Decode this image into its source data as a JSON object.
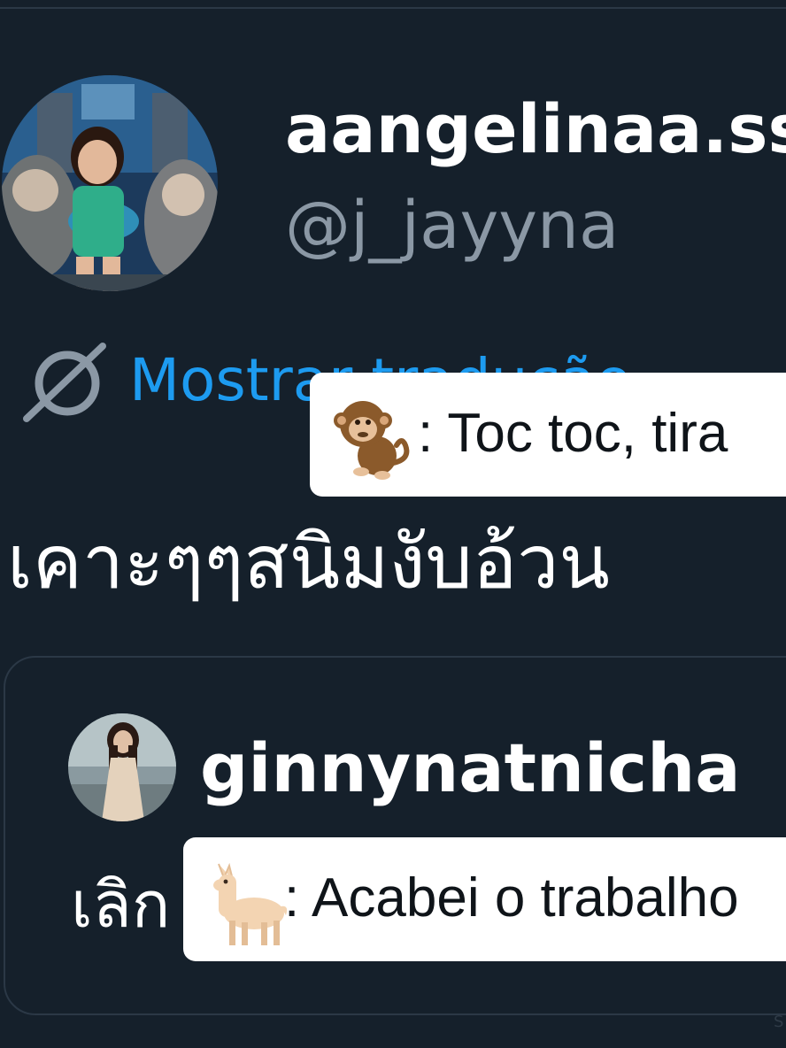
{
  "post": {
    "author": {
      "display_name": "aangelinaa.ss",
      "handle": "@j_jayyna"
    },
    "translate_label": "Mostrar tradução",
    "text": "เคาะๆๆสนิมงับอ้วน"
  },
  "quoted_post": {
    "author": {
      "display_name": "ginnynatnicha"
    },
    "text": "เลิก"
  },
  "captions": {
    "monkey": {
      "emoji": "monkey-emoji",
      "text": ": Toc toc, tira"
    },
    "llama": {
      "emoji": "llama-emoji",
      "text": ": Acabei o trabalho"
    }
  },
  "watermark": "S",
  "colors": {
    "background": "#15202b",
    "link_blue": "#1d9bf0",
    "handle_gray": "#8b98a5",
    "border": "#2b3846",
    "caption_bg": "#ffffff"
  }
}
